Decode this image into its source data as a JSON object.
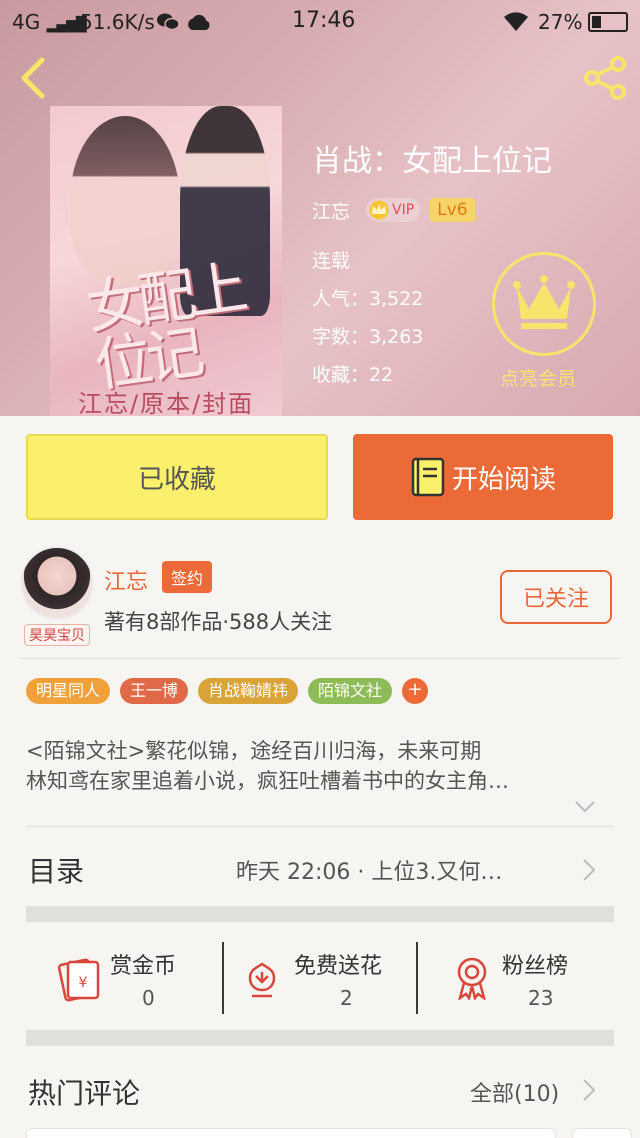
{
  "status_bar": {
    "network": "4G",
    "speed": "51.6K/s",
    "time": "17:46",
    "battery": "27%"
  },
  "book": {
    "title": "肖战：女配上位记",
    "author": "江忘",
    "vip_label": "VIP",
    "level": "Lv6",
    "state": "连载",
    "popularity": "人气：3,522",
    "word_count": "字数：3,263",
    "favorites": "收藏：22",
    "cover_title": "女配上位记",
    "cover_authors": "江忘/原本/封面",
    "member_label": "点亮会员"
  },
  "actions": {
    "favorited_label": "已收藏",
    "start_reading_label": "开始阅读"
  },
  "author_card": {
    "name": "江忘",
    "signed_badge": "签约",
    "stats": "著有8部作品·588人关注",
    "follow_label": "已关注",
    "avatar_badge": "昊昊宝贝"
  },
  "tags": [
    {
      "label": "明星同人",
      "color": "#f0a13a"
    },
    {
      "label": "王一博",
      "color": "#e06a48"
    },
    {
      "label": "肖战鞠婧祎",
      "color": "#d9a437"
    },
    {
      "label": "陌锦文社",
      "color": "#8dbb55"
    }
  ],
  "intro": {
    "line1": "<陌锦文社>繁花似锦，途经百川归海，未来可期",
    "line2": "林知鸢在家里追着小说，疯狂吐槽着书中的女主角…"
  },
  "toc": {
    "label": "目录",
    "latest": "昨天 22:06 · 上位3.又何…"
  },
  "stats": [
    {
      "label": "赏金币",
      "value": "0",
      "icon": "red-envelope-icon"
    },
    {
      "label": "免费送花",
      "value": "2",
      "icon": "flower-icon"
    },
    {
      "label": "粉丝榜",
      "value": "23",
      "icon": "medal-icon"
    }
  ],
  "comments": {
    "label": "热门评论",
    "all_label": "全部(10)"
  },
  "colors": {
    "accent": "#ec6a38",
    "favorite_button": "#fbf06c",
    "member_gold": "#f6e56a"
  }
}
